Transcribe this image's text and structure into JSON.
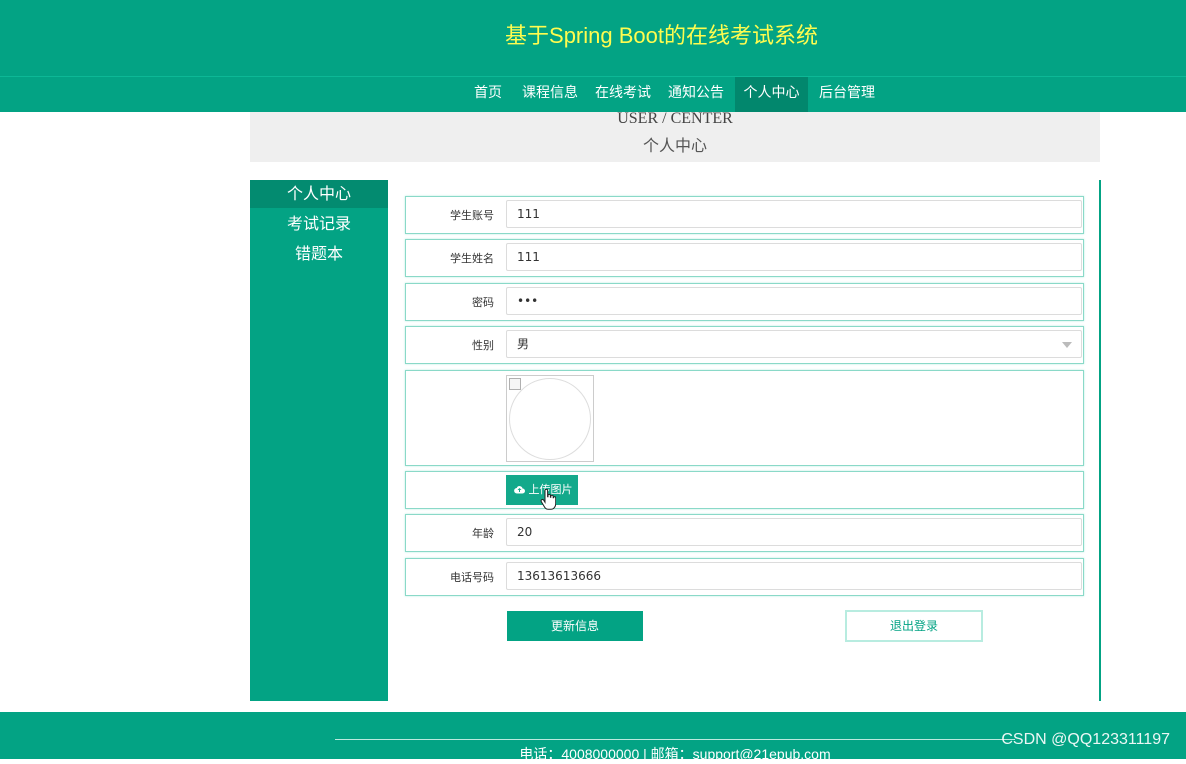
{
  "header": {
    "title": "基于Spring Boot的在线考试系统"
  },
  "nav": {
    "items": [
      {
        "label": "首页"
      },
      {
        "label": "课程信息"
      },
      {
        "label": "在线考试"
      },
      {
        "label": "通知公告"
      },
      {
        "label": "个人中心"
      },
      {
        "label": "后台管理"
      }
    ],
    "active": "个人中心"
  },
  "banner": {
    "title_en": "USER / CENTER",
    "title_cn": "个人中心"
  },
  "sidebar": {
    "items": [
      {
        "label": "个人中心"
      },
      {
        "label": "考试记录"
      },
      {
        "label": "错题本"
      }
    ],
    "active": "个人中心"
  },
  "form": {
    "account_label": "学生账号",
    "account_value": "111",
    "name_label": "学生姓名",
    "name_value": "111",
    "password_label": "密码",
    "password_value": "•••",
    "gender_label": "性别",
    "gender_value": "男",
    "upload_label": "上传图片",
    "age_label": "年龄",
    "age_value": "20",
    "phone_label": "电话号码",
    "phone_value": "13613613666"
  },
  "actions": {
    "update_label": "更新信息",
    "logout_label": "退出登录"
  },
  "footer": {
    "contact": "电话：4008000000 | 邮箱：support@21epub.com"
  },
  "watermark": "CSDN @QQ123311197",
  "colors": {
    "primary": "#03a384",
    "primary_dark": "#02876d",
    "title": "#fffc4f"
  },
  "icons": [
    "upload-cloud-icon",
    "hand-cursor-icon",
    "chevron-down-icon",
    "broken-image-icon"
  ]
}
